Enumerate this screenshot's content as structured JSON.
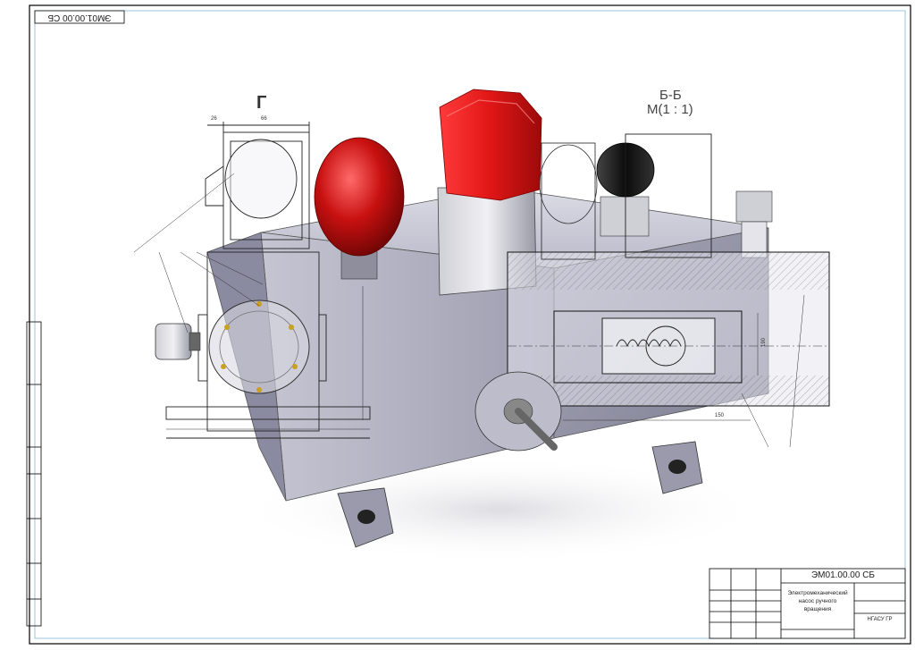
{
  "sheet": {
    "corner_stamp": "ЭМ01.00.00 СБ",
    "view_label_g": "Г",
    "section_title": "Б-Б",
    "section_scale": "М(1 : 1)"
  },
  "title_block": {
    "designation": "ЭМ01.00.00 СБ",
    "name_line1": "Электромеханический",
    "name_line2": "насос ручного",
    "name_line3": "вращения",
    "org": "НГАСУ ГР"
  },
  "dimensions": {
    "top_a": "26",
    "top_b": "66",
    "base_dim": "150",
    "right_dim": "190"
  },
  "colors": {
    "background": "#ffffff",
    "frame": "#000000",
    "body_metal": "#b9b9c9",
    "red_cap": "#d21616",
    "black_knob": "#1a1a1a",
    "section_overlay": "#e6e6ee"
  }
}
